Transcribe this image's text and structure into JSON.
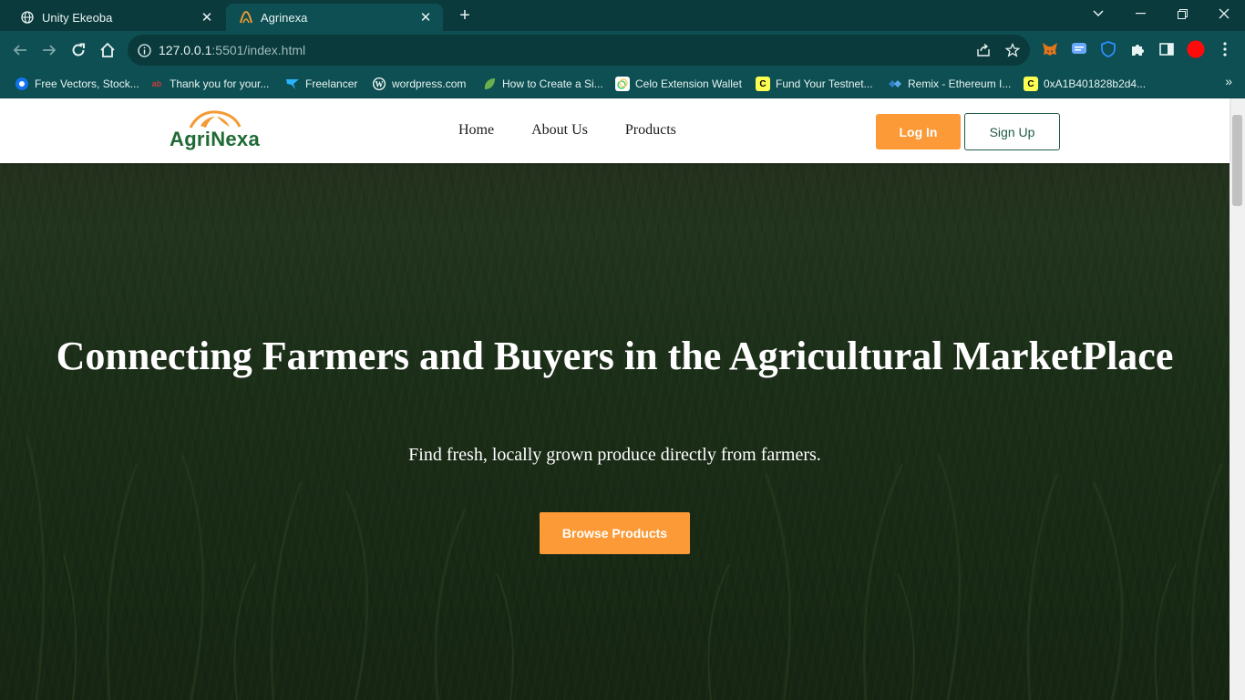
{
  "browser": {
    "tabs": [
      {
        "title": "Unity Ekeoba",
        "active": false
      },
      {
        "title": "Agrinexa",
        "active": true
      }
    ],
    "address": {
      "host": "127.0.0.1",
      "path": ":5501/index.html"
    },
    "bookmarks": [
      {
        "label": "Free Vectors, Stock...",
        "icon": "freepik-icon"
      },
      {
        "label": "Thank you for your...",
        "icon": "ab-icon"
      },
      {
        "label": "Freelancer",
        "icon": "freelancer-icon"
      },
      {
        "label": "wordpress.com",
        "icon": "wordpress-icon"
      },
      {
        "label": "How to Create a Si...",
        "icon": "leaf-icon"
      },
      {
        "label": "Celo Extension Wallet",
        "icon": "celo-icon"
      },
      {
        "label": "Fund Your Testnet...",
        "icon": "c-icon"
      },
      {
        "label": "Remix - Ethereum I...",
        "icon": "remix-icon"
      },
      {
        "label": "0xA1B401828b2d4...",
        "icon": "c-icon"
      }
    ],
    "accent": "#0d4f52"
  },
  "site": {
    "logo_text": "AgriNexa",
    "nav": [
      "Home",
      "About Us",
      "Products"
    ],
    "login_label": "Log In",
    "signup_label": "Sign Up",
    "hero": {
      "headline": "Connecting Farmers and Buyers in the Agricultural MarketPlace",
      "subtitle": "Find fresh, locally grown produce directly from farmers.",
      "cta_label": "Browse Products"
    },
    "colors": {
      "orange": "#fb9a36",
      "green": "#1f6a34"
    }
  }
}
